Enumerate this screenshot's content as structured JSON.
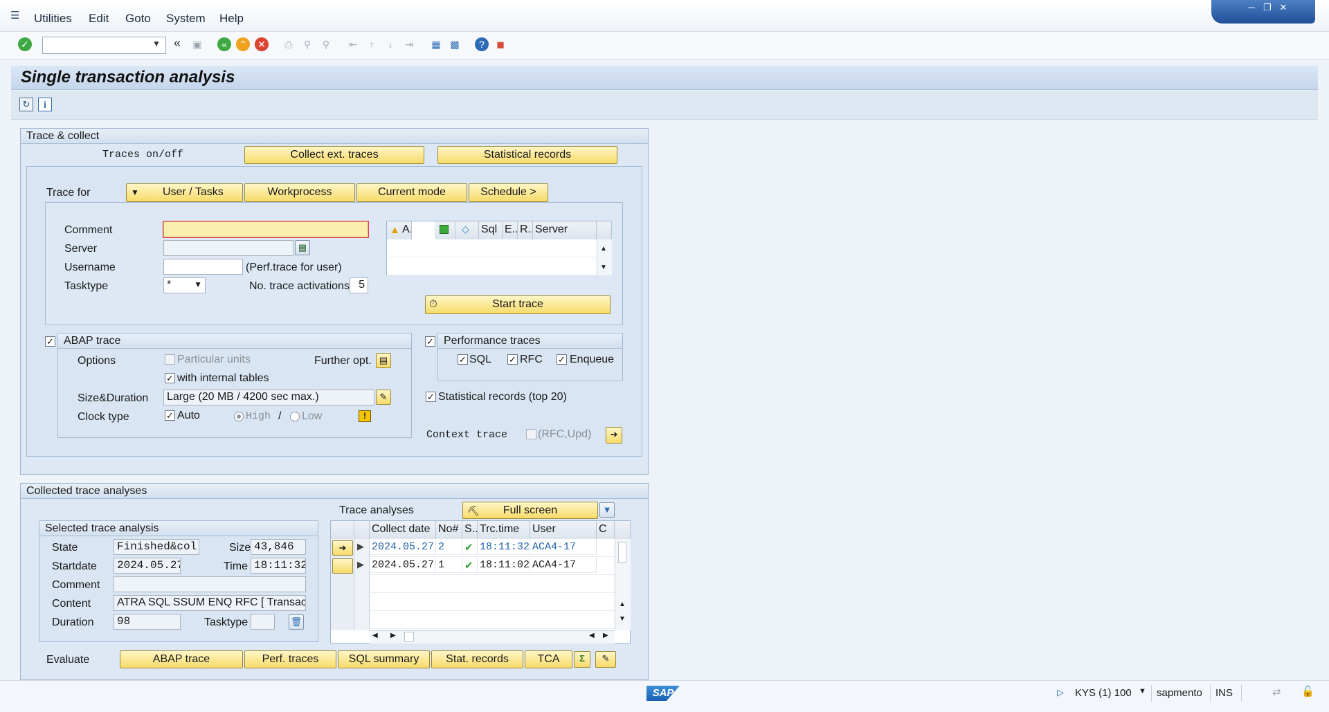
{
  "menubar": {
    "items": [
      "Utilities",
      "Edit",
      "Goto",
      "System",
      "Help"
    ]
  },
  "window": {
    "title": "Single transaction analysis"
  },
  "trace_collect": {
    "header": "Trace & collect",
    "traces_onoff": "Traces on/off",
    "collect_ext": "Collect ext. traces",
    "statistical_records": "Statistical records",
    "trace_for": "Trace for",
    "tabs": [
      "User / Tasks",
      "Workprocess",
      "Current mode",
      "Schedule >"
    ],
    "comment_label": "Comment",
    "comment_value": "",
    "server_label": "Server",
    "server_value": "",
    "username_label": "Username",
    "username_value": "",
    "perf_hint": "(Perf.trace for user)",
    "tasktype_label": "Tasktype",
    "tasktype_value": "*",
    "activations_label": "No. trace activations",
    "activations_value": "5",
    "server_grid_headers": [
      "A...",
      "",
      "",
      "Sql",
      "E..",
      "R..",
      "Server"
    ],
    "start_trace": "Start trace"
  },
  "abap_trace": {
    "header": "ABAP trace",
    "options_label": "Options",
    "particular_units": "Particular units",
    "internal_tables": "with internal tables",
    "further_opt": "Further opt.",
    "size_label": "Size&Duration",
    "size_value": "Large (20 MB / 4200 sec max.)",
    "clock_label": "Clock type",
    "auto": "Auto",
    "high": "High",
    "slash": "/",
    "low": "Low"
  },
  "perf_traces": {
    "header": "Performance traces",
    "sql": "SQL",
    "rfc": "RFC",
    "enqueue": "Enqueue",
    "stat_top": "Statistical records (top 20)",
    "context_trace": "Context trace",
    "context_hint": "(RFC,Upd)"
  },
  "collected": {
    "header": "Collected trace analyses",
    "selected_header": "Selected trace analysis",
    "state_label": "State",
    "state_value": "Finished&col..",
    "size_label": "Size",
    "size_value": "43,846",
    "startdate_label": "Startdate",
    "startdate_value": "2024.05.27",
    "time_label": "Time",
    "time_value": "18:11:32",
    "comment_label": "Comment",
    "comment_value": "",
    "content_label": "Content",
    "content_value": "ATRA SQL SSUM ENQ RFC [ Transac..",
    "duration_label": "Duration",
    "duration_value": "98",
    "tasktype_label": "Tasktype",
    "tasktype_value": "",
    "trace_analyses": "Trace analyses",
    "full_screen": "Full screen",
    "table_headers": [
      "Collect date",
      "No#",
      "S..",
      "Trc.time",
      "User",
      "C"
    ],
    "rows": [
      {
        "date": "2024.05.27",
        "no": "2",
        "time": "18:11:32",
        "user": "ACA4-17"
      },
      {
        "date": "2024.05.27",
        "no": "1",
        "time": "18:11:02",
        "user": "ACA4-17"
      }
    ],
    "evaluate": "Evaluate",
    "eval_buttons": [
      "ABAP trace",
      "Perf. traces",
      "SQL summary",
      "Stat. records",
      "TCA"
    ]
  },
  "statusbar": {
    "logo": "SAP",
    "system": "KYS (1) 100",
    "user": "sapmento",
    "mode": "INS"
  }
}
